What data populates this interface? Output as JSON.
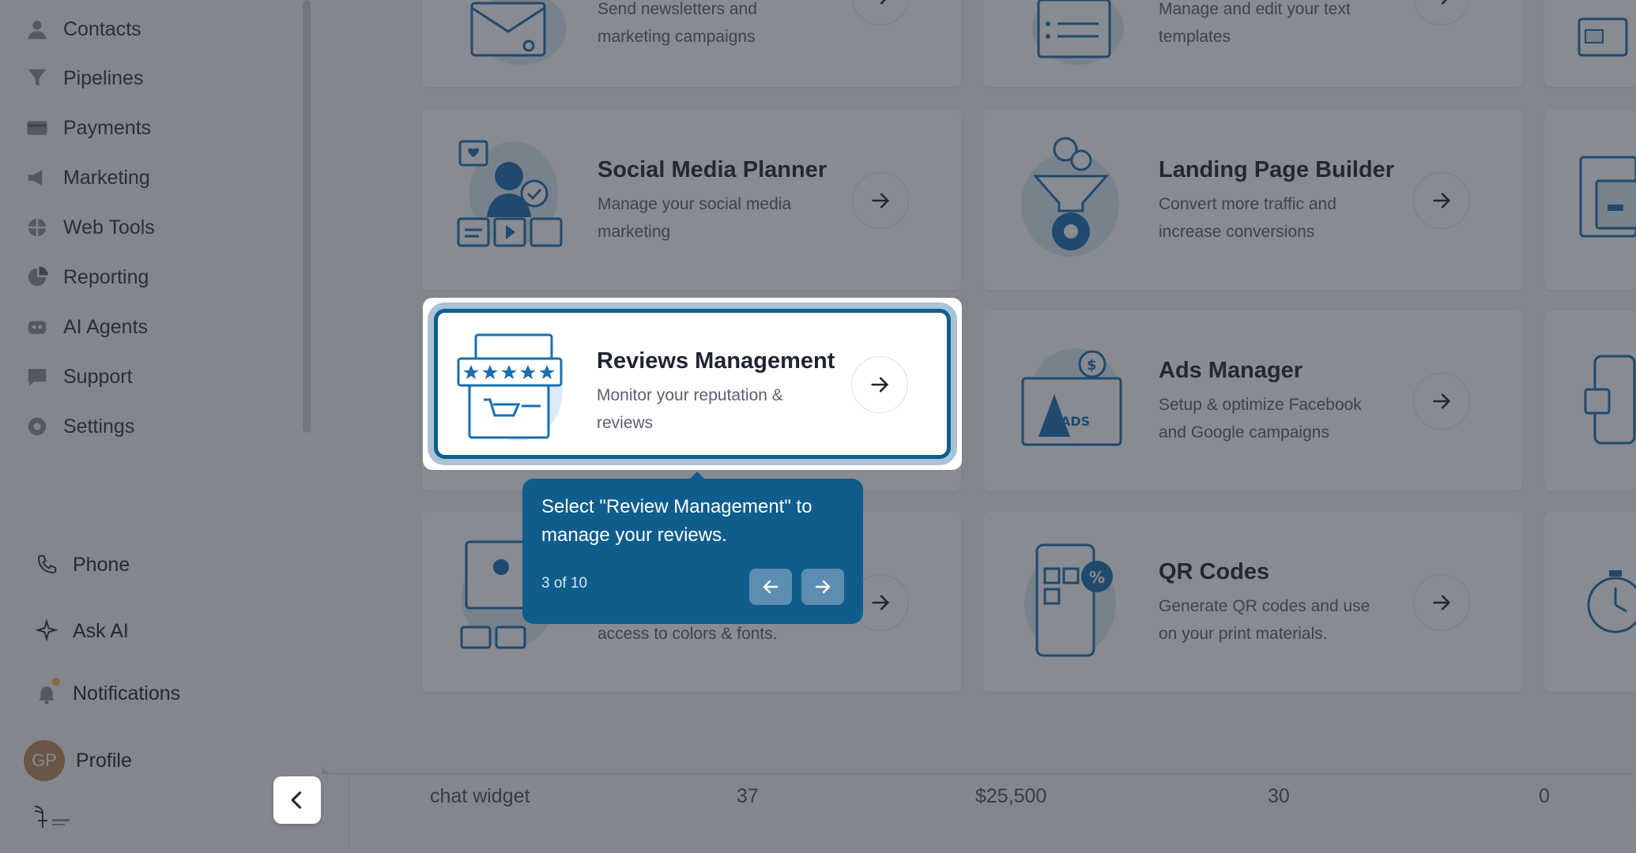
{
  "sidebar": {
    "nav_items": [
      {
        "label": "Contacts",
        "icon": "person-icon"
      },
      {
        "label": "Pipelines",
        "icon": "funnel-icon"
      },
      {
        "label": "Payments",
        "icon": "card-icon"
      },
      {
        "label": "Marketing",
        "icon": "megaphone-icon"
      },
      {
        "label": "Web Tools",
        "icon": "globe-icon"
      },
      {
        "label": "Reporting",
        "icon": "pie-chart-icon"
      },
      {
        "label": "AI Agents",
        "icon": "robot-icon"
      },
      {
        "label": "Support",
        "icon": "chat-icon"
      },
      {
        "label": "Settings",
        "icon": "gear-icon"
      }
    ],
    "phone_label": "Phone",
    "ask_ai_label": "Ask AI",
    "notifications_label": "Notifications",
    "profile_label": "Profile",
    "avatar_initials": "GP"
  },
  "table_row": {
    "name": "chat widget",
    "count": "37",
    "amount": "$25,500",
    "metric": "30",
    "other": "0"
  },
  "cards": {
    "email": {
      "desc_line1": "Send newsletters and",
      "desc_line2": "marketing campaigns"
    },
    "templates": {
      "desc_line1": "Manage and edit your text",
      "desc_line2": "templates"
    },
    "social": {
      "title": "Social Media Planner",
      "desc_line1": "Manage your social media",
      "desc_line2": "marketing"
    },
    "landing": {
      "title": "Landing Page Builder",
      "desc_line1": "Convert more traffic and",
      "desc_line2": "increase conversions"
    },
    "reviews": {
      "title": "Reviews Management",
      "desc_line1": "Monitor your reputation &",
      "desc_line2": "reviews"
    },
    "ads": {
      "title": "Ads Manager",
      "desc_line1": "Setup & optimize Facebook",
      "desc_line2": "and Google campaigns"
    },
    "brand": {
      "desc_line2": "access to colors & fonts."
    },
    "qr": {
      "title": "QR Codes",
      "desc_line1": "Generate QR codes and use",
      "desc_line2": "on your print materials."
    }
  },
  "tooltip": {
    "text": "Select \"Review Management\" to manage your reviews.",
    "step": "3 of 10"
  },
  "colors": {
    "accent": "#0f5d8c",
    "illustration_blue": "#1a6fb0",
    "illustration_light": "#dcebf7"
  }
}
